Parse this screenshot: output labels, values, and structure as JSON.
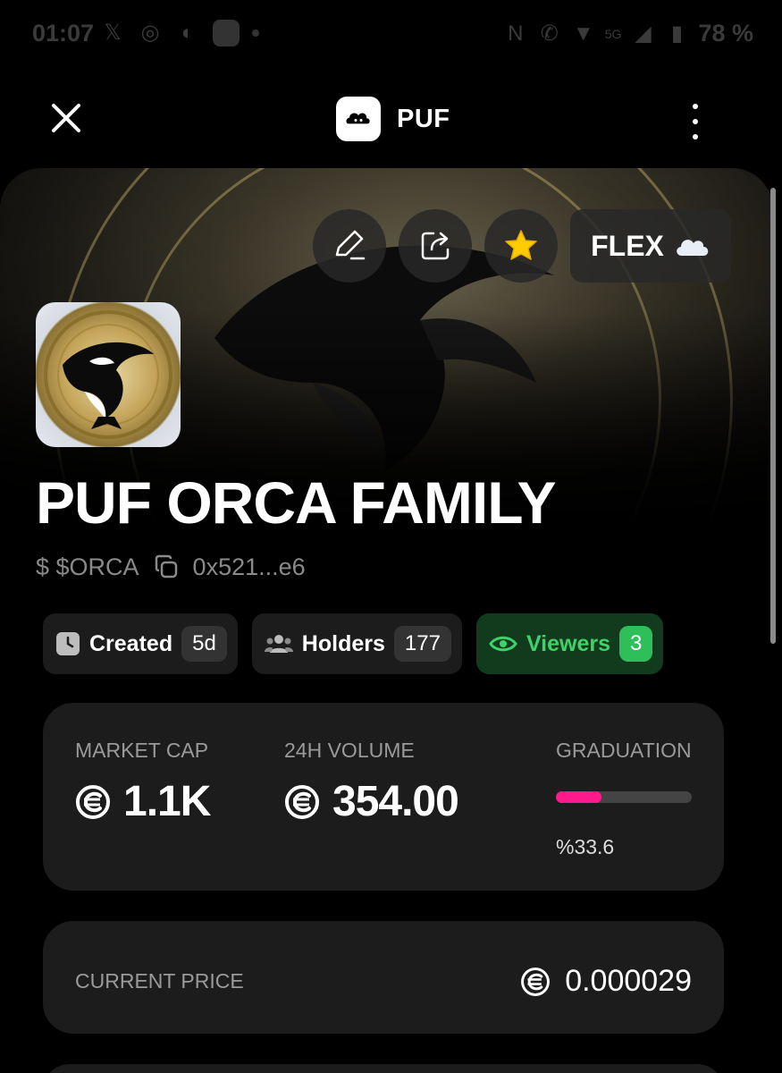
{
  "status_bar": {
    "time": "01:07",
    "battery": "78 %",
    "network": "5G"
  },
  "header": {
    "title": "PUF"
  },
  "banner": {
    "flex_label": "FLEX"
  },
  "token": {
    "name": "PUF ORCA FAMILY",
    "ticker": "$ $ORCA",
    "address": "0x521...e6"
  },
  "chips": {
    "created_label": "Created",
    "created_value": "5d",
    "holders_label": "Holders",
    "holders_value": "177",
    "viewers_label": "Viewers",
    "viewers_value": "3"
  },
  "stats": {
    "market_cap_label": "MARKET CAP",
    "market_cap_value": "1.1K",
    "volume_label": "24H VOLUME",
    "volume_value": "354.00",
    "graduation_label": "GRADUATION",
    "graduation_percent_text": "%33.6",
    "graduation_fraction": 0.336
  },
  "price": {
    "label": "CURRENT PRICE",
    "value": "0.000029"
  },
  "colors": {
    "accent_pink": "#ff1a8c",
    "viewers_green": "#2fbf5a",
    "card_bg": "#1c1c1c"
  }
}
